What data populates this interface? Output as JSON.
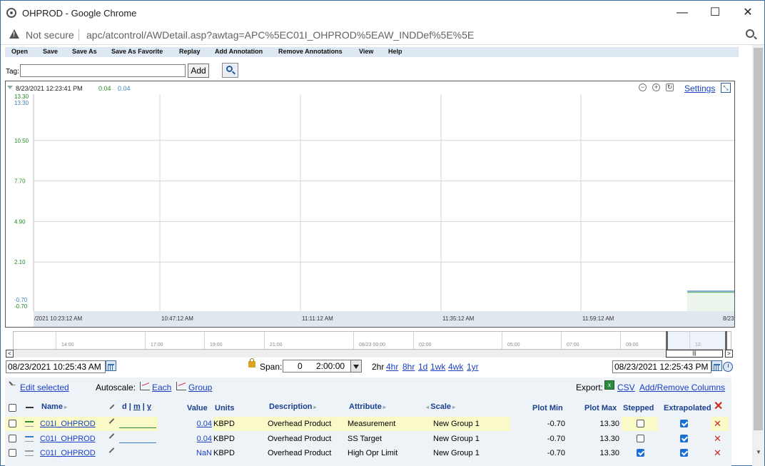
{
  "window": {
    "title": "OHPROD - Google Chrome",
    "minimize": "—",
    "maximize": "☐",
    "close": "✕"
  },
  "address": {
    "security": "Not secure",
    "url": "apc/atcontrol/AWDetail.asp?awtag=APC%5EC01I_OHPROD%5EAW_INDDef%5E%5E"
  },
  "menu": [
    "Open",
    "Save",
    "Save As",
    "Save As Favorite",
    "Replay",
    "Add Annotation",
    "Remove Annotations",
    "View",
    "Help"
  ],
  "tag": {
    "label": "Tag:",
    "value": "",
    "add_label": "Add"
  },
  "chart_header": {
    "timestamp": "8/23/2021 12:23:41 PM",
    "value1": "0.04",
    "value2": "0.04",
    "settings_label": "Settings"
  },
  "chart_data": {
    "type": "line",
    "y_ticks_green": [
      "13.30",
      "10.50",
      "7.70",
      "4.90",
      "2.10",
      "-0.70"
    ],
    "y_ticks_blue": [
      "13.30",
      "-0.70"
    ],
    "ylim": [
      -0.7,
      13.3
    ],
    "x_ticks": [
      "/2021 10:23:12  AM",
      "10:47:12  AM",
      "11:11:12  AM",
      "11:35:12  AM",
      "11:59:12  AM",
      "8/23"
    ],
    "series": [
      {
        "values": [
          0.04,
          0.04,
          0.04
        ],
        "color": "#1f8b1f"
      },
      {
        "values": [
          0.04,
          0.04,
          0.04
        ],
        "color": "#3a7fc1"
      }
    ],
    "grid": true
  },
  "navigator": {
    "ticks": [
      "14:00",
      "17:00",
      "19:00",
      "21:00",
      "08/23 00:00",
      "02:00",
      "05:00",
      "07:00",
      "09:00",
      "12:"
    ],
    "thumb_glyph": "|||",
    "left_arrow": "<",
    "right_arrow": ">"
  },
  "time_controls": {
    "start": "08/23/2021 10:25:43  AM",
    "end": "08/23/2021 12:25:43  PM",
    "span_label": "Span:",
    "span_days": "0",
    "span_time": "2:00:00",
    "quick_current": "2hr",
    "quick_links": [
      "4hr",
      "8hr",
      "1d",
      "1wk",
      "4wk",
      "1yr"
    ]
  },
  "grid_toolbar": {
    "edit_selected": "Edit selected",
    "autoscale_label": "Autoscale:",
    "each_label": "Each",
    "group_label": "Group",
    "export_label": "Export:",
    "csv_label": "CSV",
    "add_remove_cols": "Add/Remove Columns"
  },
  "grid_headers": {
    "name": "Name",
    "dmy_d": "d",
    "dmy_m": "m",
    "dmy_y": "y",
    "value": "Value",
    "units": "Units",
    "description": "Description",
    "attribute": "Attribute",
    "scale": "Scale",
    "plot_min": "Plot Min",
    "plot_max": "Plot Max",
    "stepped": "Stepped",
    "extrapolated": "Extrapolated"
  },
  "rows": [
    {
      "name": "C01I_OHPROD",
      "value": "0.04",
      "units": "KBPD",
      "description": "Overhead Product",
      "attribute": "Measurement",
      "scale": "New Group 1",
      "plot_min": "-0.70",
      "plot_max": "13.30",
      "stepped": false,
      "extrapolated": true,
      "color": "#2e8b2e"
    },
    {
      "name": "C01I_OHPROD",
      "value": "0.04",
      "units": "KBPD",
      "description": "Overhead Product",
      "attribute": "SS Target",
      "scale": "New Group 1",
      "plot_min": "-0.70",
      "plot_max": "13.30",
      "stepped": false,
      "extrapolated": true,
      "color": "#3a7fc1"
    },
    {
      "name": "C01I_OHPROD",
      "value": "NaN",
      "units": "KBPD",
      "description": "Overhead Product",
      "attribute": "High Opr Limit",
      "scale": "New Group 1",
      "plot_min": "-0.70",
      "plot_max": "13.30",
      "stepped": true,
      "extrapolated": true,
      "color": "#999999"
    }
  ]
}
